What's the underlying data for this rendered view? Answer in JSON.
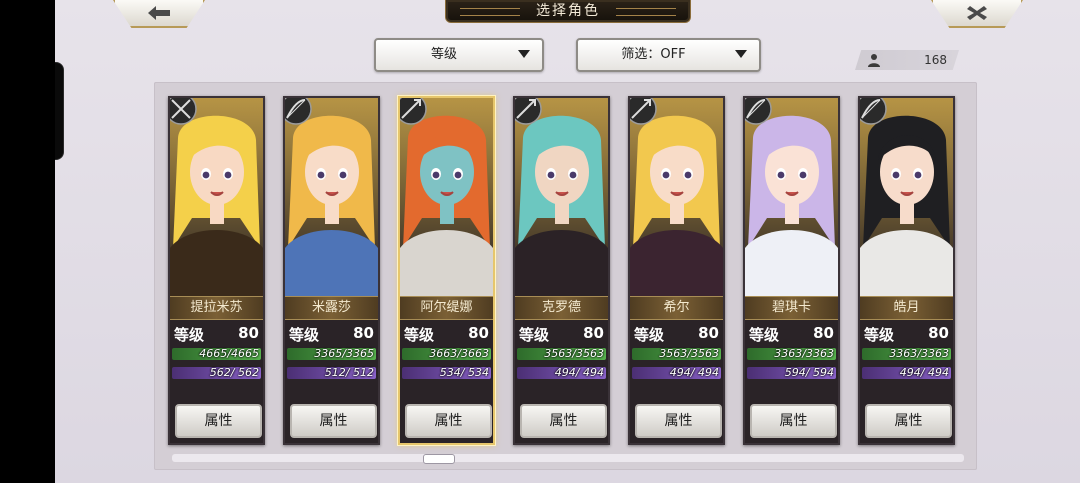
{
  "screen": {
    "title": "选择角色",
    "back_icon": "arrow-left-icon",
    "close_icon": "x-icon"
  },
  "sort_dropdown": {
    "label": "等级",
    "icon": "caret-down-icon"
  },
  "filter_dropdown": {
    "label": "筛选：OFF",
    "icon": "caret-down-icon"
  },
  "character_count": {
    "icon": "person-icon",
    "value": "168"
  },
  "characters": [
    {
      "name": "提拉米苏",
      "level_label": "等级",
      "level": "80",
      "hp": "4665/4665",
      "sp": "562/ 562",
      "attr_label": "属性",
      "class_icon": "crossed-weapons-icon",
      "hair": "#f4d04a",
      "skin": "#f8d9c3",
      "bg": "#cfa84a",
      "outfit": "#3a2a1a"
    },
    {
      "name": "米露莎",
      "level_label": "等级",
      "level": "80",
      "hp": "3365/3365",
      "sp": "512/ 512",
      "attr_label": "属性",
      "class_icon": "bow-icon",
      "hair": "#f0b94a",
      "skin": "#f8dcc8",
      "bg": "#7fc3c7",
      "outfit": "#4e74b7"
    },
    {
      "name": "阿尔缇娜",
      "level_label": "等级",
      "level": "80",
      "hp": "3663/3663",
      "sp": "534/ 534",
      "attr_label": "属性",
      "class_icon": "lance-icon",
      "hair": "#e36a2e",
      "skin": "#7fc2c4",
      "bg": "#c48e4a",
      "outfit": "#d9d5cf"
    },
    {
      "name": "克罗德",
      "level_label": "等级",
      "level": "80",
      "hp": "3563/3563",
      "sp": "494/ 494",
      "attr_label": "属性",
      "class_icon": "lance-icon",
      "hair": "#6cc7c0",
      "skin": "#f0d6c2",
      "bg": "#4a3c52",
      "outfit": "#2b2226"
    },
    {
      "name": "希尔",
      "level_label": "等级",
      "level": "80",
      "hp": "3563/3563",
      "sp": "494/ 494",
      "attr_label": "属性",
      "class_icon": "lance-icon",
      "hair": "#f2c84e",
      "skin": "#f8dcc8",
      "bg": "#8d6b8c",
      "outfit": "#3b2430"
    },
    {
      "name": "碧琪卡",
      "level_label": "等级",
      "level": "80",
      "hp": "3363/3363",
      "sp": "594/ 594",
      "attr_label": "属性",
      "class_icon": "bow-icon",
      "hair": "#cbb6e8",
      "skin": "#fae2d6",
      "bg": "#b4a5d8",
      "outfit": "#eef0f6"
    },
    {
      "name": "皓月",
      "level_label": "等级",
      "level": "80",
      "hp": "3363/3363",
      "sp": "494/ 494",
      "attr_label": "属性",
      "class_icon": "bow-icon",
      "hair": "#1f1f22",
      "skin": "#f7dccb",
      "bg": "#9ad08a",
      "outfit": "#e9e8e6"
    }
  ],
  "selected_index": 2,
  "scroll": {
    "position": 0.33
  }
}
